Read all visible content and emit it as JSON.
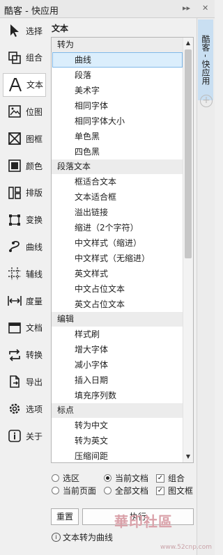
{
  "window": {
    "title": "酷客 - 快应用",
    "pin_icon": "pin-icon",
    "close_icon": "close-icon"
  },
  "sidebar": {
    "items": [
      {
        "label": "选择",
        "icon": "cursor-icon"
      },
      {
        "label": "组合",
        "icon": "group-icon"
      },
      {
        "label": "文本",
        "icon": "text-icon",
        "active": true
      },
      {
        "label": "位图",
        "icon": "image-icon"
      },
      {
        "label": "图框",
        "icon": "frame-icon"
      },
      {
        "label": "颜色",
        "icon": "color-icon"
      },
      {
        "label": "排版",
        "icon": "layout-icon"
      },
      {
        "label": "变换",
        "icon": "transform-icon"
      },
      {
        "label": "曲线",
        "icon": "curve-icon"
      },
      {
        "label": "辅线",
        "icon": "guide-icon"
      },
      {
        "label": "度量",
        "icon": "measure-icon"
      },
      {
        "label": "文档",
        "icon": "document-icon"
      },
      {
        "label": "转换",
        "icon": "convert-icon"
      },
      {
        "label": "导出",
        "icon": "export-icon"
      },
      {
        "label": "选项",
        "icon": "gear-icon"
      },
      {
        "label": "关于",
        "icon": "info-icon"
      }
    ]
  },
  "panel": {
    "heading": "文本",
    "list": [
      {
        "type": "group",
        "label": "转为"
      },
      {
        "type": "item",
        "label": "曲线",
        "selected": true
      },
      {
        "type": "item",
        "label": "段落"
      },
      {
        "type": "item",
        "label": "美术字"
      },
      {
        "type": "item",
        "label": "相同字体"
      },
      {
        "type": "item",
        "label": "相同字体大小"
      },
      {
        "type": "item",
        "label": "单色黑"
      },
      {
        "type": "item",
        "label": "四色黑"
      },
      {
        "type": "group",
        "label": "段落文本"
      },
      {
        "type": "item",
        "label": "框适合文本"
      },
      {
        "type": "item",
        "label": "文本适合框"
      },
      {
        "type": "item",
        "label": "溢出链接"
      },
      {
        "type": "item",
        "label": "缩进（2个字符）"
      },
      {
        "type": "item",
        "label": "中文样式（缩进）"
      },
      {
        "type": "item",
        "label": "中文样式（无缩进）"
      },
      {
        "type": "item",
        "label": "英文样式"
      },
      {
        "type": "item",
        "label": "中文占位文本"
      },
      {
        "type": "item",
        "label": "英文占位文本"
      },
      {
        "type": "group",
        "label": "编辑"
      },
      {
        "type": "item",
        "label": "样式刷"
      },
      {
        "type": "item",
        "label": "增大字体"
      },
      {
        "type": "item",
        "label": "减小字体"
      },
      {
        "type": "item",
        "label": "插入日期"
      },
      {
        "type": "item",
        "label": "填充序列数"
      },
      {
        "type": "group",
        "label": "标点"
      },
      {
        "type": "item",
        "label": "转为中文"
      },
      {
        "type": "item",
        "label": "转为英文"
      },
      {
        "type": "item",
        "label": "压缩间距"
      }
    ],
    "options": {
      "selection": "选区",
      "current_doc": "当前文档",
      "group": "组合",
      "current_page": "当前页面",
      "all_docs": "全部文档",
      "graphic_frame": "图文框",
      "selected_radio": "current_doc",
      "group_checked": true,
      "graphic_frame_checked": true
    },
    "buttons": {
      "reset": "重置",
      "execute": "执行"
    },
    "hint": "文本转为曲线"
  },
  "right_tabs": {
    "active_tab": "酷客 - 快应用",
    "add_icon": "plus-icon"
  },
  "watermark": {
    "text": "華印社區",
    "url": "www.52cnp.com"
  }
}
